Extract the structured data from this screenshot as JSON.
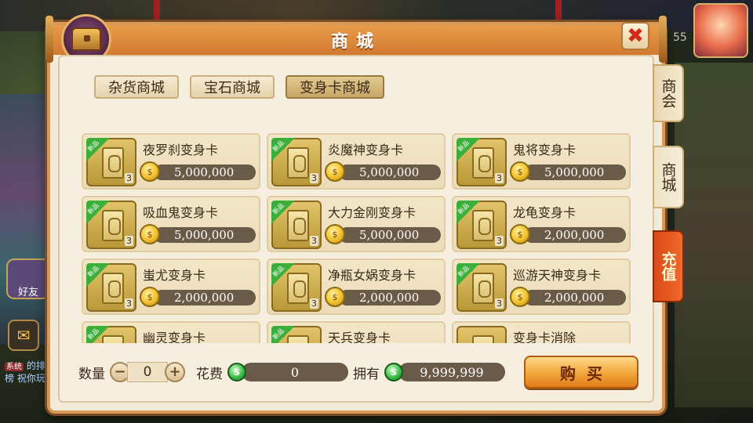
{
  "window": {
    "title": "商城"
  },
  "sub_tabs": [
    {
      "label": "杂货商城",
      "active": false
    },
    {
      "label": "宝石商城",
      "active": false
    },
    {
      "label": "变身卡商城",
      "active": true
    }
  ],
  "side_tabs": [
    {
      "label": "商会"
    },
    {
      "label": "商城"
    },
    {
      "label": "充值"
    }
  ],
  "items": [
    {
      "name": "夜罗刹变身卡",
      "price": "5,000,000",
      "badge": "新品",
      "qty": "3"
    },
    {
      "name": "炎魔神变身卡",
      "price": "5,000,000",
      "badge": "新品",
      "qty": "3"
    },
    {
      "name": "鬼将变身卡",
      "price": "5,000,000",
      "badge": "新品",
      "qty": "3"
    },
    {
      "name": "吸血鬼变身卡",
      "price": "5,000,000",
      "badge": "新品",
      "qty": "3"
    },
    {
      "name": "大力金刚变身卡",
      "price": "5,000,000",
      "badge": "新品",
      "qty": "3"
    },
    {
      "name": "龙龟变身卡",
      "price": "2,000,000",
      "badge": "新品",
      "qty": "3"
    },
    {
      "name": "蚩尤变身卡",
      "price": "2,000,000",
      "badge": "新品",
      "qty": "3"
    },
    {
      "name": "净瓶女娲变身卡",
      "price": "2,000,000",
      "badge": "新品",
      "qty": "3"
    },
    {
      "name": "巡游天神变身卡",
      "price": "2,000,000",
      "badge": "新品",
      "qty": "3"
    },
    {
      "name": "幽灵变身卡",
      "price": "",
      "badge": "新品",
      "qty": ""
    },
    {
      "name": "天兵变身卡",
      "price": "",
      "badge": "新品",
      "qty": ""
    },
    {
      "name": "变身卡消除",
      "price": "",
      "badge": "",
      "qty": ""
    }
  ],
  "bottom": {
    "quantity_label": "数量",
    "quantity_value": "0",
    "minus": "−",
    "plus": "+",
    "cost_label": "花费",
    "cost_value": "0",
    "owned_label": "拥有",
    "owned_value": "9,999,999",
    "buy_label": "购买"
  },
  "hud": {
    "friends_label": "好友",
    "sys_tag": "系统",
    "sys_text": "的排行榜 祝你玩",
    "level": "55"
  },
  "colors": {
    "title_bar": "#d27a30",
    "new_badge": "#3cae3a",
    "recharge_tab": "#e0521e",
    "buy_button": "#f2a53a"
  }
}
